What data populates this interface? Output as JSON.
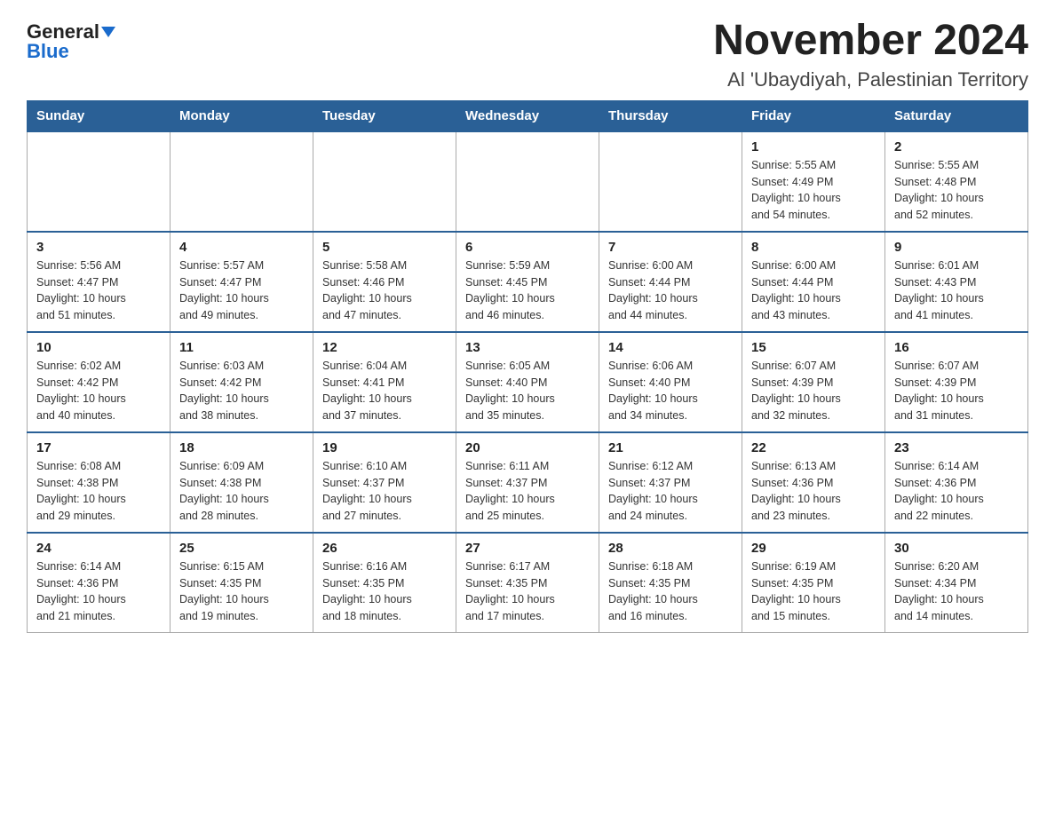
{
  "header": {
    "logo_general": "General",
    "logo_blue": "Blue",
    "title": "November 2024",
    "subtitle": "Al 'Ubaydiyah, Palestinian Territory"
  },
  "weekdays": [
    "Sunday",
    "Monday",
    "Tuesday",
    "Wednesday",
    "Thursday",
    "Friday",
    "Saturday"
  ],
  "weeks": [
    [
      {
        "day": "",
        "info": ""
      },
      {
        "day": "",
        "info": ""
      },
      {
        "day": "",
        "info": ""
      },
      {
        "day": "",
        "info": ""
      },
      {
        "day": "",
        "info": ""
      },
      {
        "day": "1",
        "info": "Sunrise: 5:55 AM\nSunset: 4:49 PM\nDaylight: 10 hours\nand 54 minutes."
      },
      {
        "day": "2",
        "info": "Sunrise: 5:55 AM\nSunset: 4:48 PM\nDaylight: 10 hours\nand 52 minutes."
      }
    ],
    [
      {
        "day": "3",
        "info": "Sunrise: 5:56 AM\nSunset: 4:47 PM\nDaylight: 10 hours\nand 51 minutes."
      },
      {
        "day": "4",
        "info": "Sunrise: 5:57 AM\nSunset: 4:47 PM\nDaylight: 10 hours\nand 49 minutes."
      },
      {
        "day": "5",
        "info": "Sunrise: 5:58 AM\nSunset: 4:46 PM\nDaylight: 10 hours\nand 47 minutes."
      },
      {
        "day": "6",
        "info": "Sunrise: 5:59 AM\nSunset: 4:45 PM\nDaylight: 10 hours\nand 46 minutes."
      },
      {
        "day": "7",
        "info": "Sunrise: 6:00 AM\nSunset: 4:44 PM\nDaylight: 10 hours\nand 44 minutes."
      },
      {
        "day": "8",
        "info": "Sunrise: 6:00 AM\nSunset: 4:44 PM\nDaylight: 10 hours\nand 43 minutes."
      },
      {
        "day": "9",
        "info": "Sunrise: 6:01 AM\nSunset: 4:43 PM\nDaylight: 10 hours\nand 41 minutes."
      }
    ],
    [
      {
        "day": "10",
        "info": "Sunrise: 6:02 AM\nSunset: 4:42 PM\nDaylight: 10 hours\nand 40 minutes."
      },
      {
        "day": "11",
        "info": "Sunrise: 6:03 AM\nSunset: 4:42 PM\nDaylight: 10 hours\nand 38 minutes."
      },
      {
        "day": "12",
        "info": "Sunrise: 6:04 AM\nSunset: 4:41 PM\nDaylight: 10 hours\nand 37 minutes."
      },
      {
        "day": "13",
        "info": "Sunrise: 6:05 AM\nSunset: 4:40 PM\nDaylight: 10 hours\nand 35 minutes."
      },
      {
        "day": "14",
        "info": "Sunrise: 6:06 AM\nSunset: 4:40 PM\nDaylight: 10 hours\nand 34 minutes."
      },
      {
        "day": "15",
        "info": "Sunrise: 6:07 AM\nSunset: 4:39 PM\nDaylight: 10 hours\nand 32 minutes."
      },
      {
        "day": "16",
        "info": "Sunrise: 6:07 AM\nSunset: 4:39 PM\nDaylight: 10 hours\nand 31 minutes."
      }
    ],
    [
      {
        "day": "17",
        "info": "Sunrise: 6:08 AM\nSunset: 4:38 PM\nDaylight: 10 hours\nand 29 minutes."
      },
      {
        "day": "18",
        "info": "Sunrise: 6:09 AM\nSunset: 4:38 PM\nDaylight: 10 hours\nand 28 minutes."
      },
      {
        "day": "19",
        "info": "Sunrise: 6:10 AM\nSunset: 4:37 PM\nDaylight: 10 hours\nand 27 minutes."
      },
      {
        "day": "20",
        "info": "Sunrise: 6:11 AM\nSunset: 4:37 PM\nDaylight: 10 hours\nand 25 minutes."
      },
      {
        "day": "21",
        "info": "Sunrise: 6:12 AM\nSunset: 4:37 PM\nDaylight: 10 hours\nand 24 minutes."
      },
      {
        "day": "22",
        "info": "Sunrise: 6:13 AM\nSunset: 4:36 PM\nDaylight: 10 hours\nand 23 minutes."
      },
      {
        "day": "23",
        "info": "Sunrise: 6:14 AM\nSunset: 4:36 PM\nDaylight: 10 hours\nand 22 minutes."
      }
    ],
    [
      {
        "day": "24",
        "info": "Sunrise: 6:14 AM\nSunset: 4:36 PM\nDaylight: 10 hours\nand 21 minutes."
      },
      {
        "day": "25",
        "info": "Sunrise: 6:15 AM\nSunset: 4:35 PM\nDaylight: 10 hours\nand 19 minutes."
      },
      {
        "day": "26",
        "info": "Sunrise: 6:16 AM\nSunset: 4:35 PM\nDaylight: 10 hours\nand 18 minutes."
      },
      {
        "day": "27",
        "info": "Sunrise: 6:17 AM\nSunset: 4:35 PM\nDaylight: 10 hours\nand 17 minutes."
      },
      {
        "day": "28",
        "info": "Sunrise: 6:18 AM\nSunset: 4:35 PM\nDaylight: 10 hours\nand 16 minutes."
      },
      {
        "day": "29",
        "info": "Sunrise: 6:19 AM\nSunset: 4:35 PM\nDaylight: 10 hours\nand 15 minutes."
      },
      {
        "day": "30",
        "info": "Sunrise: 6:20 AM\nSunset: 4:34 PM\nDaylight: 10 hours\nand 14 minutes."
      }
    ]
  ]
}
